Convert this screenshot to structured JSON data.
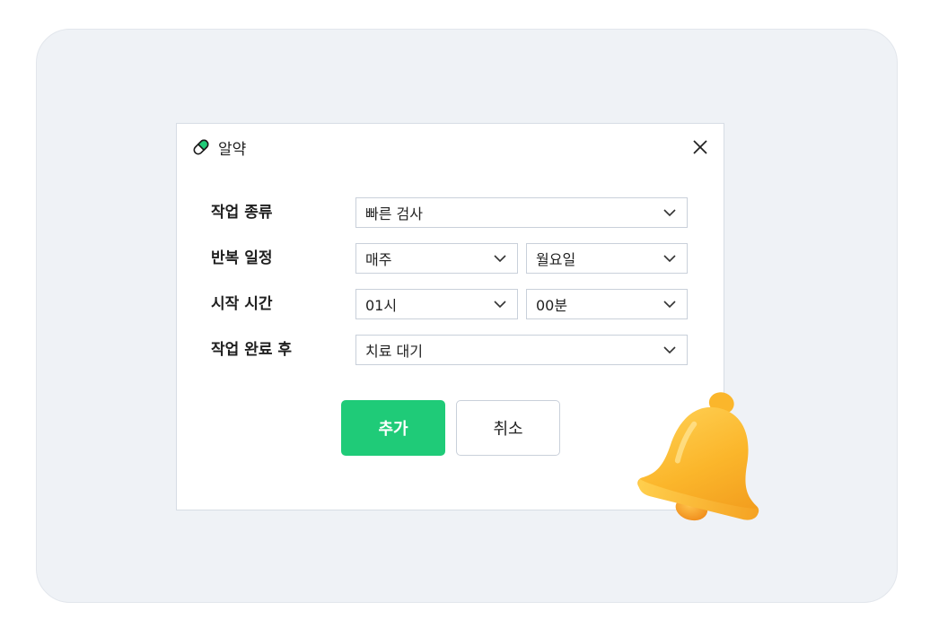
{
  "dialog": {
    "title": "알약",
    "title_icon": "pill-icon",
    "close_icon": "close-icon",
    "accent_color": "#1fcb78"
  },
  "form": {
    "task_type": {
      "label": "작업 종류",
      "value": "빠른 검사"
    },
    "repeat_schedule": {
      "label": "반복 일정",
      "frequency": "매주",
      "day": "월요일"
    },
    "start_time": {
      "label": "시작 시간",
      "hour": "01시",
      "minute": "00분"
    },
    "after_task": {
      "label": "작업 완료 후",
      "value": "치료 대기"
    }
  },
  "buttons": {
    "add_label": "추가",
    "cancel_label": "취소"
  },
  "decoration": {
    "bell_icon": "bell-icon"
  }
}
